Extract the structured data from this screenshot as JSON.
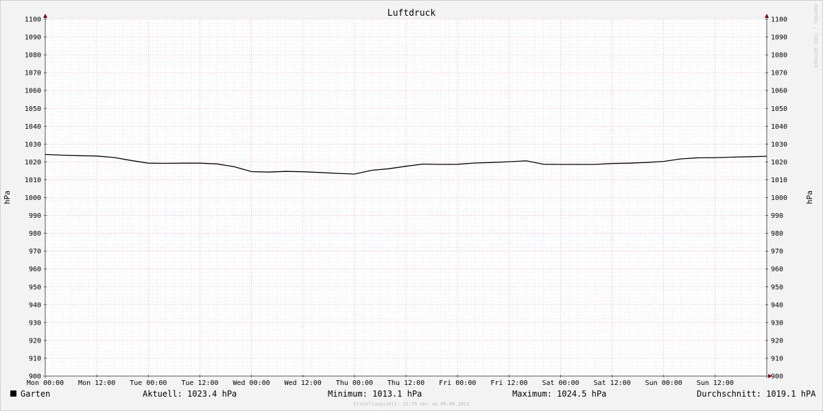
{
  "chart_data": {
    "type": "line",
    "title": "Luftdruck",
    "ylabel": "hPa",
    "ylim": [
      900,
      1100
    ],
    "y_major_step": 10,
    "x_tick_labels": [
      "Mon 00:00",
      "Mon 12:00",
      "Tue 00:00",
      "Tue 12:00",
      "Wed 00:00",
      "Wed 12:00",
      "Thu 00:00",
      "Thu 12:00",
      "Fri 00:00",
      "Fri 12:00",
      "Sat 00:00",
      "Sat 12:00",
      "Sun 00:00",
      "Sun 12:00"
    ],
    "x_unit": "hours since Mon 00:00",
    "xlim": [
      0,
      168
    ],
    "grid": true,
    "series": [
      {
        "name": "Garten",
        "color": "#000000",
        "x": [
          0,
          4,
          8,
          12,
          16,
          20,
          24,
          28,
          32,
          36,
          40,
          44,
          48,
          52,
          56,
          60,
          64,
          68,
          72,
          76,
          80,
          84,
          88,
          92,
          96,
          100,
          104,
          108,
          112,
          116,
          120,
          124,
          128,
          132,
          136,
          140,
          144,
          148,
          152,
          156,
          160,
          164,
          168
        ],
        "y": [
          1024.2,
          1023.8,
          1023.5,
          1023.3,
          1022.5,
          1020.8,
          1019.3,
          1019.2,
          1019.3,
          1019.3,
          1018.9,
          1017.3,
          1014.6,
          1014.3,
          1014.7,
          1014.5,
          1014.1,
          1013.6,
          1013.2,
          1015.3,
          1016.2,
          1017.6,
          1018.8,
          1018.6,
          1018.7,
          1019.4,
          1019.7,
          1020.1,
          1020.6,
          1018.7,
          1018.6,
          1018.6,
          1018.6,
          1019.1,
          1019.3,
          1019.7,
          1020.3,
          1021.7,
          1022.3,
          1022.4,
          1022.7,
          1022.9,
          1023.2
        ]
      }
    ]
  },
  "watermark": "RRDTOOL / TOBI OETIKER",
  "legend": {
    "series_name": "Garten",
    "swatch_color": "#000000",
    "current": "Aktuell: 1023.4 hPa",
    "minimum": "Minimum: 1013.1 hPa",
    "maximum": "Maximum: 1024.5 hPa",
    "average": "Durchschnitt: 1019.1 hPA"
  },
  "footer": "Erstellungszeit: 23:55 Uhr am 06.06.2021",
  "colors": {
    "background": "#f3f3f3",
    "plot_background": "#ffffff",
    "major_grid": "#e89090",
    "minor_grid": "#d0d0d0",
    "axis": "#555555",
    "arrow": "#8b0000"
  }
}
